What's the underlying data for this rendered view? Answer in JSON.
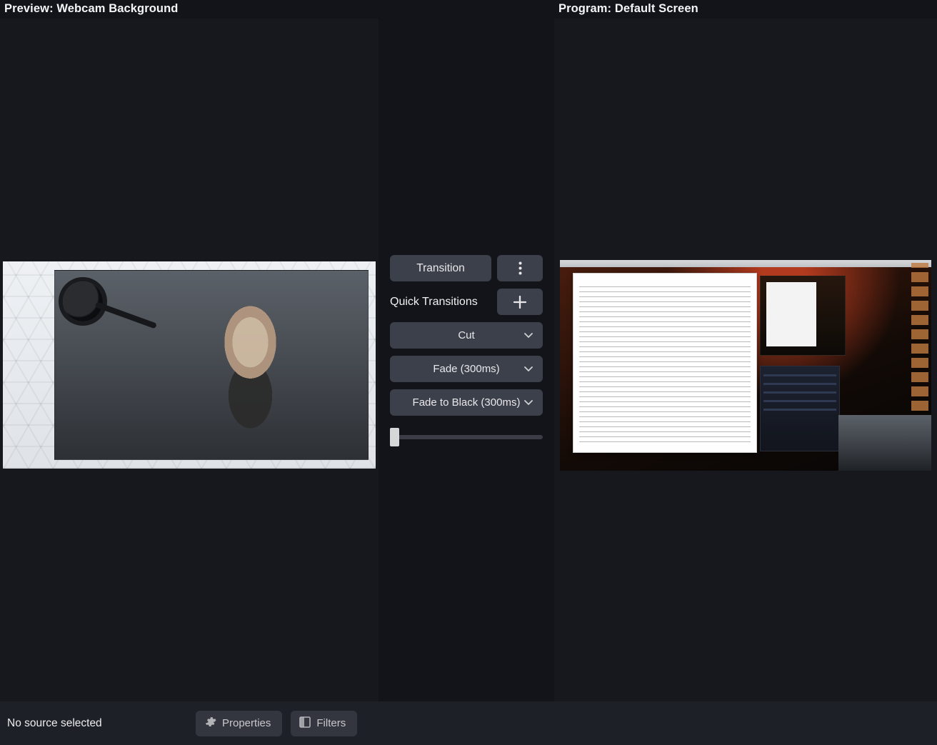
{
  "preview": {
    "title": "Preview: Webcam Background"
  },
  "program": {
    "title": "Program: Default Screen"
  },
  "transition": {
    "button": "Transition",
    "quick_label": "Quick Transitions",
    "options": {
      "cut": "Cut",
      "fade": "Fade (300ms)",
      "fade_black": "Fade to Black (300ms)"
    },
    "slider_value": 0
  },
  "footer": {
    "status": "No source selected",
    "properties": "Properties",
    "filters": "Filters"
  }
}
